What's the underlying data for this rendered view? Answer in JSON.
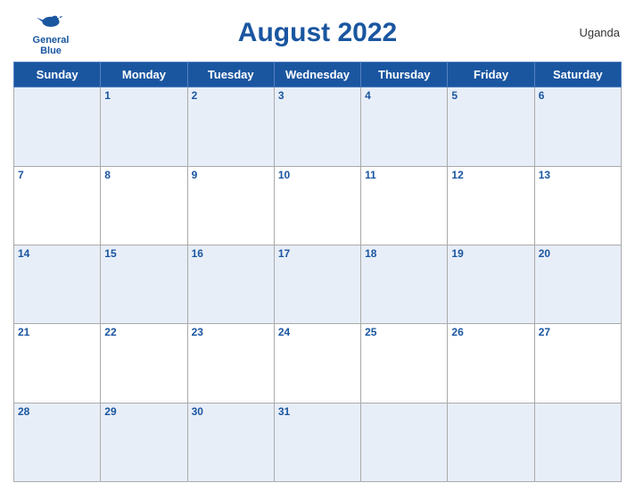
{
  "header": {
    "logo": {
      "line1": "General",
      "line2": "Blue"
    },
    "title": "August 2022",
    "country": "Uganda"
  },
  "weekdays": [
    "Sunday",
    "Monday",
    "Tuesday",
    "Wednesday",
    "Thursday",
    "Friday",
    "Saturday"
  ],
  "weeks": [
    [
      {
        "day": "",
        "empty": true
      },
      {
        "day": "1"
      },
      {
        "day": "2"
      },
      {
        "day": "3"
      },
      {
        "day": "4"
      },
      {
        "day": "5"
      },
      {
        "day": "6"
      }
    ],
    [
      {
        "day": "7"
      },
      {
        "day": "8"
      },
      {
        "day": "9"
      },
      {
        "day": "10"
      },
      {
        "day": "11"
      },
      {
        "day": "12"
      },
      {
        "day": "13"
      }
    ],
    [
      {
        "day": "14"
      },
      {
        "day": "15"
      },
      {
        "day": "16"
      },
      {
        "day": "17"
      },
      {
        "day": "18"
      },
      {
        "day": "19"
      },
      {
        "day": "20"
      }
    ],
    [
      {
        "day": "21"
      },
      {
        "day": "22"
      },
      {
        "day": "23"
      },
      {
        "day": "24"
      },
      {
        "day": "25"
      },
      {
        "day": "26"
      },
      {
        "day": "27"
      }
    ],
    [
      {
        "day": "28"
      },
      {
        "day": "29"
      },
      {
        "day": "30"
      },
      {
        "day": "31"
      },
      {
        "day": ""
      },
      {
        "day": ""
      },
      {
        "day": ""
      }
    ]
  ],
  "accent_color": "#1a56a0"
}
